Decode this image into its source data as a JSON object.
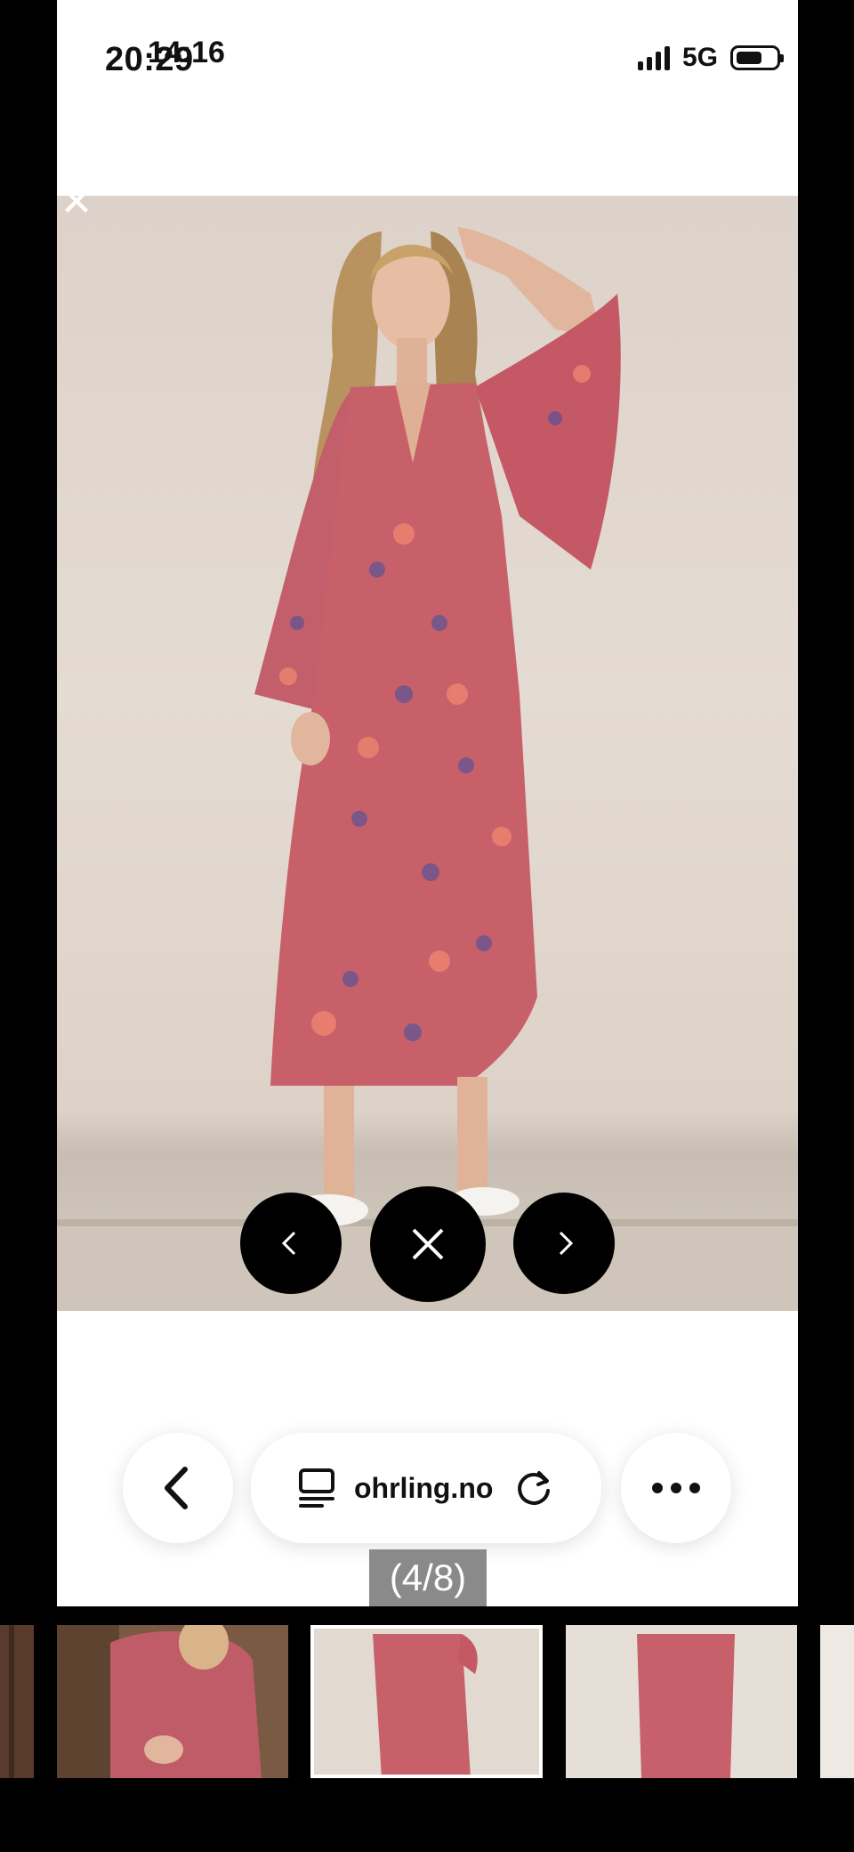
{
  "status_bar": {
    "time": "20:29",
    "time_overlay": "14:16",
    "network": "5G"
  },
  "viewer": {
    "counter": "(4/8)",
    "close_small_icon": "close-icon",
    "prev_icon": "chevron-left-icon",
    "close_icon": "close-icon",
    "next_icon": "chevron-right-icon"
  },
  "browser_toolbar": {
    "back_icon": "chevron-left-icon",
    "reader_icon": "reader-mode-icon",
    "url_text": "ohrling.no",
    "reload_icon": "reload-icon",
    "more_icon": "more-icon"
  },
  "thumbnails": {
    "count_visible": 6,
    "selected_index": 2
  },
  "colors": {
    "background": "#000000",
    "page": "#ffffff",
    "dress_primary": "#c8606a",
    "wall": "#e2d9d0"
  }
}
